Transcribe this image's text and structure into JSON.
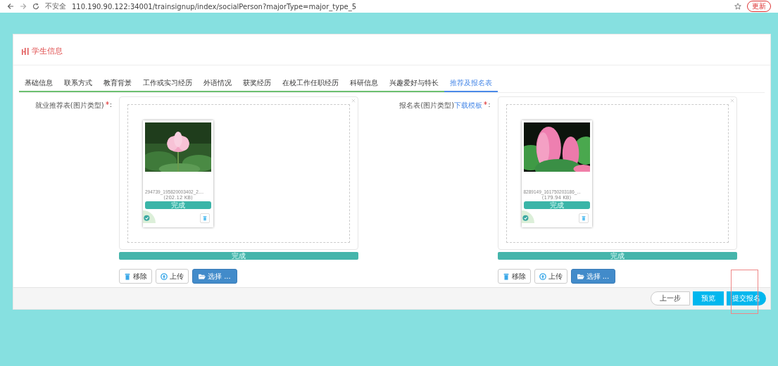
{
  "browser": {
    "security": "不安全",
    "url": "110.190.90.122:34001/trainsignup/index/socialPerson?majorType=major_type_5",
    "update_label": "更新"
  },
  "panel": {
    "title": "学生信息"
  },
  "tabs": [
    {
      "label": "基础信息",
      "selected": false
    },
    {
      "label": "联系方式",
      "selected": false
    },
    {
      "label": "教育背景",
      "selected": false
    },
    {
      "label": "工作或实习经历",
      "selected": false
    },
    {
      "label": "外语情况",
      "selected": false
    },
    {
      "label": "获奖经历",
      "selected": false
    },
    {
      "label": "在校工作任职经历",
      "selected": false
    },
    {
      "label": "科研信息",
      "selected": false
    },
    {
      "label": "兴趣爱好与特长",
      "selected": false
    },
    {
      "label": "推荐及报名表",
      "selected": true
    }
  ],
  "uploads": [
    {
      "label": "就业推荐表(图片类型)",
      "required": true,
      "separator": ":",
      "file": {
        "name": "294739_195820003402_2....",
        "size": "(202.12 KB)",
        "progress_label": "完成",
        "level": 1,
        "uploaded": true
      },
      "status": "完成",
      "level": 1,
      "buttons": [
        {
          "kind": "remove",
          "label": "移除"
        },
        {
          "kind": "upload",
          "label": "上传"
        },
        {
          "kind": "browse",
          "label": "选择 ..."
        }
      ]
    },
    {
      "label": "报名表(图片类型)",
      "link": "下载模板",
      "required": true,
      "separator": ":",
      "file": {
        "name": "8289149_161750203186_...",
        "size": "(179.94 KB)",
        "progress_label": "完成",
        "level": 1,
        "uploaded": true
      },
      "status": "完成",
      "level": 1,
      "buttons": [
        {
          "kind": "remove",
          "label": "移除"
        },
        {
          "kind": "upload",
          "label": "上传"
        },
        {
          "kind": "browse",
          "label": "选择 ..."
        }
      ]
    }
  ],
  "footer": {
    "buttons": [
      {
        "kind": "outline",
        "label": "上一步"
      },
      {
        "kind": "primary",
        "label": "预览"
      },
      {
        "kind": "submit",
        "label": "提交报名"
      }
    ]
  },
  "annotation_frame": true
}
